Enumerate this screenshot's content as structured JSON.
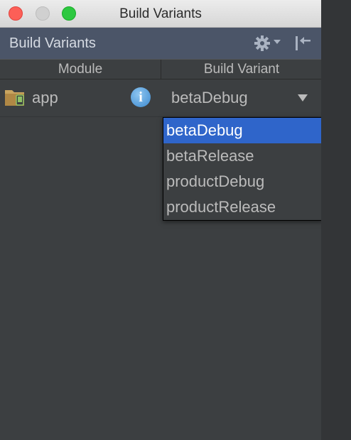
{
  "window": {
    "title": "Build Variants"
  },
  "toolwindow": {
    "title": "Build Variants",
    "gear_icon": "gear-icon",
    "hide_icon": "hide-panel-icon"
  },
  "table": {
    "columns": [
      "Module",
      "Build Variant"
    ],
    "rows": [
      {
        "module": "app",
        "variant": "betaDebug",
        "folder_icon": "android-module-folder-icon",
        "info_icon": "info-icon"
      }
    ]
  },
  "dropdown": {
    "options": [
      "betaDebug",
      "betaRelease",
      "productDebug",
      "productRelease"
    ],
    "selected": "betaDebug",
    "info_glyph": "i"
  },
  "colors": {
    "accent": "#2f65ca",
    "header": "#4b5568",
    "panel": "#3c3f41"
  }
}
